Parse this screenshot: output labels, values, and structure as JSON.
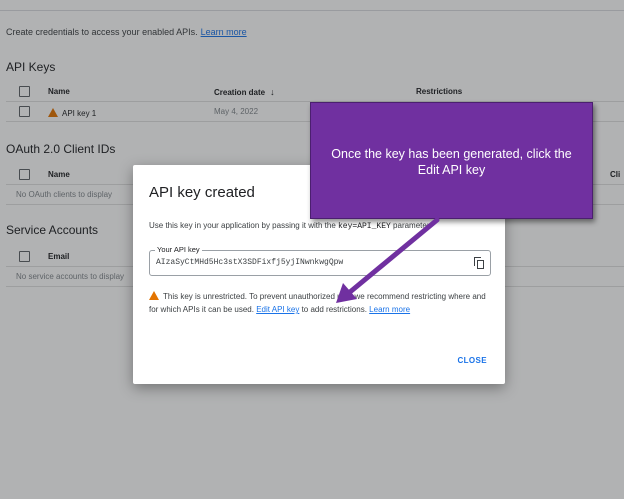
{
  "intro": {
    "text": "Create credentials to access your enabled APIs.",
    "link": "Learn more"
  },
  "api_keys": {
    "title": "API Keys",
    "columns": {
      "name": "Name",
      "creation_date": "Creation date",
      "restrictions": "Restrictions"
    },
    "rows": [
      {
        "name": "API key 1",
        "creation_date": "May 4, 2022"
      }
    ]
  },
  "oauth": {
    "title": "OAuth 2.0 Client IDs",
    "columns": {
      "name": "Name",
      "client": "Cli"
    },
    "empty": "No OAuth clients to display"
  },
  "service_accounts": {
    "title": "Service Accounts",
    "columns": {
      "email": "Email"
    },
    "empty": "No service accounts to display"
  },
  "dialog": {
    "title": "API key created",
    "desc_before": "Use this key in your application by passing it with the",
    "desc_code": "key=API_KEY",
    "desc_after": "parameter.",
    "key_label": "Your API key",
    "key_value": "AIzaSyCtMHd5Hc3stX3SDFixfj5yjINwnkwgQpw",
    "warn_before": "This key is unrestricted. To prevent unauthorized use, we recommend restricting where and for which APIs it can be used.",
    "edit_link": "Edit API key",
    "warn_mid": "to add restrictions.",
    "learn_more": "Learn more",
    "close": "CLOSE"
  },
  "callout": {
    "text": "Once the key has been generated, click the Edit API key",
    "color": "#7030a0"
  },
  "icons": {
    "warning": "warning-icon",
    "sort": "arrow-down-icon",
    "copy": "copy-icon"
  }
}
